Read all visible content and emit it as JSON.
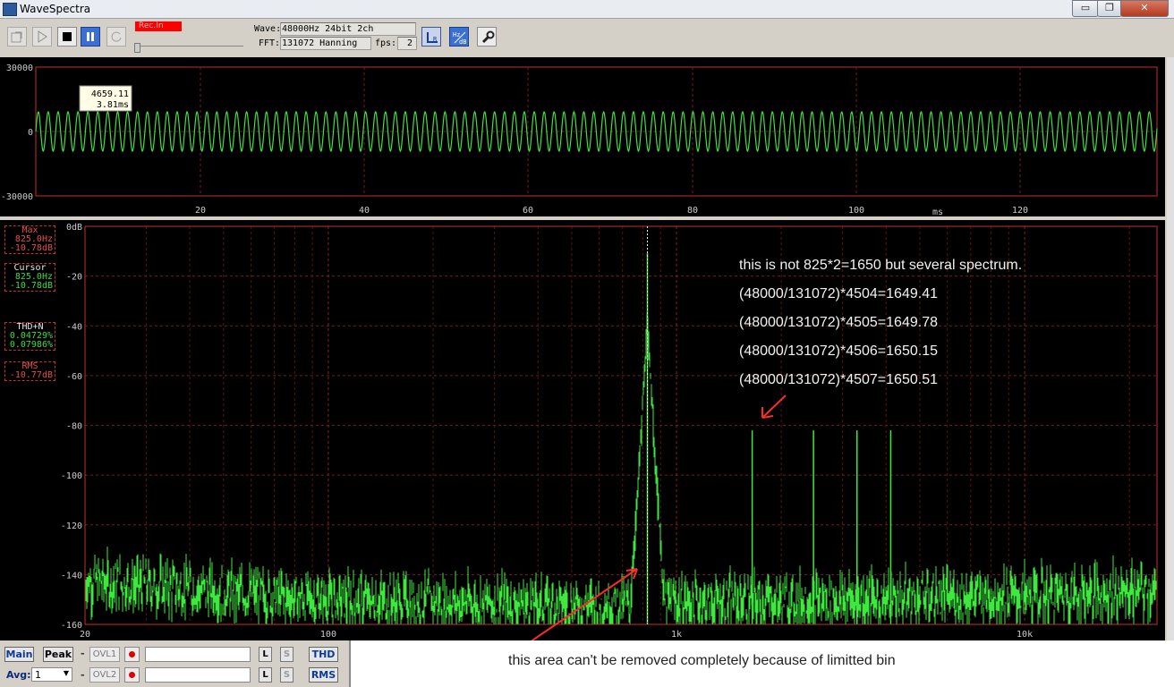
{
  "window": {
    "title": "WaveSpectra",
    "minimize_glyph": "▭",
    "restore_glyph": "❐",
    "close_glyph": "✕"
  },
  "toolbar": {
    "rec_status": "Rec.In",
    "wave_label": "Wave:",
    "wave_value": "48000Hz 24bit 2ch",
    "fft_label": "FFT:",
    "fft_value": "131072 Hanning",
    "fps_label": "fps:",
    "fps_value": "2",
    "icons": [
      "open-file-icon",
      "play-icon",
      "stop-icon",
      "pause-icon",
      "loop-icon",
      "lr-channel-icon",
      "hz-db-icon",
      "settings-wrench-icon"
    ]
  },
  "waveform": {
    "y_ticks": [
      "30000",
      "0",
      "-30000"
    ],
    "x_ticks": [
      "20",
      "40",
      "60",
      "80",
      "100",
      "120"
    ],
    "x_unit": "ms",
    "tooltip_value": "4659.11",
    "tooltip_time": "3.81ms",
    "line_color": "#40e040"
  },
  "spectrum_side": {
    "max_label": "Max",
    "max_freq": "825.0Hz",
    "max_db": "-10.78dB",
    "cursor_label": "Cursor",
    "cursor_freq": "825.0Hz",
    "cursor_db": "-10.78dB",
    "thd_label": "THD+N",
    "thd_value1": "0.04729%",
    "thd_value2": "0.07986%",
    "rms_label": "RMS",
    "rms_value": "-10.77dB"
  },
  "chart_data": {
    "type": "line",
    "title": "",
    "xlabel": "",
    "ylabel": "",
    "x_scale": "log",
    "xlim": [
      20,
      24000
    ],
    "ylim": [
      -160,
      0
    ],
    "y_ticks": [
      "0dB",
      "-20",
      "-40",
      "-60",
      "-80",
      "-100",
      "-120",
      "-140",
      "-160"
    ],
    "x_tick_labels": [
      "20",
      "100",
      "1k",
      "10k"
    ],
    "grid": true,
    "series": [
      {
        "color": "#40e040",
        "peaks": [
          {
            "x": 825,
            "y": -10.78
          },
          {
            "x": 1650,
            "y": -82
          },
          {
            "x": 2475,
            "y": -82
          },
          {
            "x": 3300,
            "y": -82
          },
          {
            "x": 4125,
            "y": -82
          }
        ],
        "noise_floor": [
          {
            "x": 20,
            "y": -142
          },
          {
            "x": 100,
            "y": -150
          },
          {
            "x": 700,
            "y": -152
          },
          {
            "x": 1000,
            "y": -151
          },
          {
            "x": 10000,
            "y": -148
          },
          {
            "x": 24000,
            "y": -146
          }
        ]
      }
    ]
  },
  "annotations": {
    "line1": "this is not 825*2=1650 but several spectrum.",
    "line2": "(48000/131072)*4504=1649.41",
    "line3": "(48000/131072)*4505=1649.78",
    "line4": "(48000/131072)*4506=1650.15",
    "line5": "(48000/131072)*4507=1650.51",
    "bottom_note": "this area can't be removed completely  because of limitted bin",
    "arrow_color": "#ff2a2a"
  },
  "bottom": {
    "main_label": "Main",
    "peak_label": "Peak",
    "avg_label": "Avg:",
    "avg_value": "1",
    "ovl1_label": "OVL1",
    "ovl2_label": "OVL2",
    "dash": "-",
    "l_label": "L",
    "s_label": "S",
    "thd_button": "THD",
    "rms_button": "RMS"
  }
}
